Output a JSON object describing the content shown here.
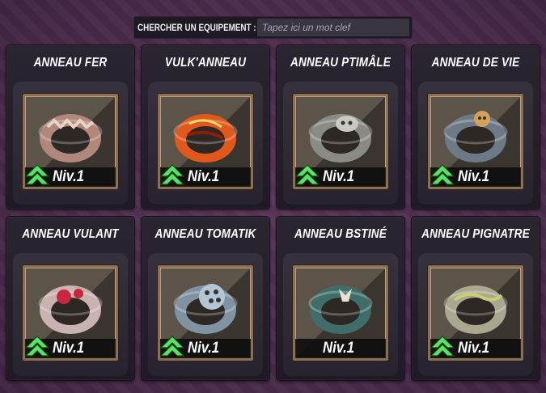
{
  "search": {
    "label": "CHERCHER UN EQUIPEMENT :",
    "placeholder": "Tapez ici un mot clef"
  },
  "items": [
    {
      "name": "ANNEAU FER",
      "level": "Niv.1",
      "icon": "iron-ring-icon",
      "color": "#b0877a",
      "accent": "#e8d4c4",
      "show_up": true
    },
    {
      "name": "VULK'ANNEAU",
      "level": "Niv.1",
      "icon": "lava-ring-icon",
      "color": "#e0581c",
      "accent": "#ffb04a",
      "show_up": true
    },
    {
      "name": "ANNEAU PTIMÂLE",
      "level": "Niv.1",
      "icon": "skull-ring-icon",
      "color": "#8b8b86",
      "accent": "#c9c9c2",
      "show_up": true
    },
    {
      "name": "ANNEAU DE VIE",
      "level": "Niv.1",
      "icon": "life-ring-icon",
      "color": "#6b7a86",
      "accent": "#d2a258",
      "show_up": true
    },
    {
      "name": "ANNEAU VULANT",
      "level": "Niv.1",
      "icon": "gem-ring-icon",
      "color": "#c9b3b0",
      "accent": "#c7263e",
      "show_up": true
    },
    {
      "name": "ANNEAU TOMATIK",
      "level": "Niv.1",
      "icon": "revolver-ring-icon",
      "color": "#7f93a3",
      "accent": "#b4c6d4",
      "show_up": true
    },
    {
      "name": "ANNEAU BSTINÉ",
      "level": "Niv.1",
      "icon": "fleur-ring-icon",
      "color": "#3f6e6a",
      "accent": "#e6e2d0",
      "show_up": false
    },
    {
      "name": "ANNEAU PIGNATRE",
      "level": "Niv.1",
      "icon": "vine-ring-icon",
      "color": "#a9a78e",
      "accent": "#c9d070",
      "show_up": true
    }
  ]
}
